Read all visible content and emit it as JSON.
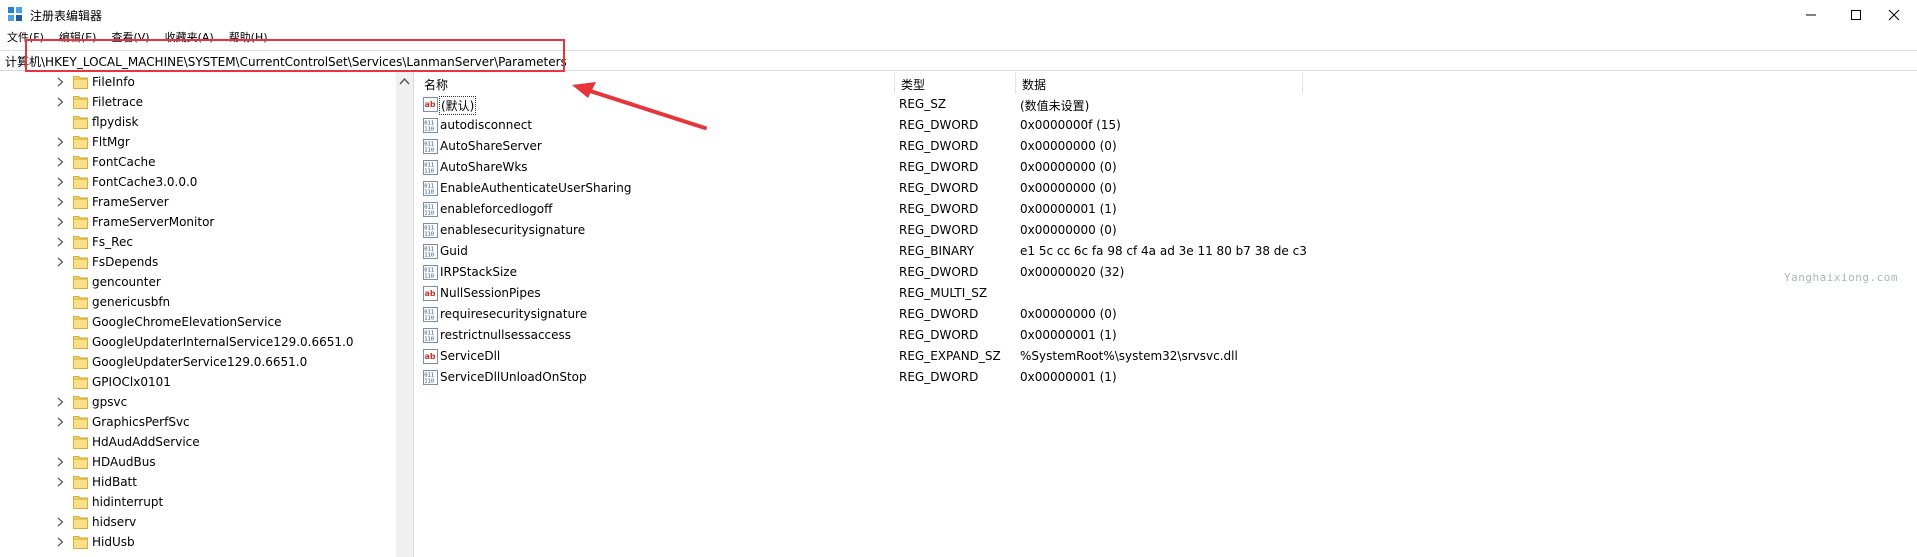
{
  "window": {
    "title": "注册表编辑器",
    "controls": [
      "minimize-icon",
      "maximize-icon",
      "close-icon"
    ]
  },
  "menu": [
    "文件(F)",
    "编辑(E)",
    "查看(V)",
    "收藏夹(A)",
    "帮助(H)"
  ],
  "address": {
    "path": "计算机\\HKEY_LOCAL_MACHINE\\SYSTEM\\CurrentControlSet\\Services\\LanmanServer\\Parameters"
  },
  "tree": {
    "items": [
      {
        "label": "FileInfo",
        "expandable": true
      },
      {
        "label": "Filetrace",
        "expandable": true
      },
      {
        "label": "flpydisk",
        "expandable": false
      },
      {
        "label": "FltMgr",
        "expandable": true
      },
      {
        "label": "FontCache",
        "expandable": true
      },
      {
        "label": "FontCache3.0.0.0",
        "expandable": true
      },
      {
        "label": "FrameServer",
        "expandable": true
      },
      {
        "label": "FrameServerMonitor",
        "expandable": true
      },
      {
        "label": "Fs_Rec",
        "expandable": true
      },
      {
        "label": "FsDepends",
        "expandable": true
      },
      {
        "label": "gencounter",
        "expandable": false
      },
      {
        "label": "genericusbfn",
        "expandable": false
      },
      {
        "label": "GoogleChromeElevationService",
        "expandable": false
      },
      {
        "label": "GoogleUpdaterInternalService129.0.6651.0",
        "expandable": false
      },
      {
        "label": "GoogleUpdaterService129.0.6651.0",
        "expandable": false
      },
      {
        "label": "GPIOClx0101",
        "expandable": false
      },
      {
        "label": "gpsvc",
        "expandable": true
      },
      {
        "label": "GraphicsPerfSvc",
        "expandable": true
      },
      {
        "label": "HdAudAddService",
        "expandable": false
      },
      {
        "label": "HDAudBus",
        "expandable": true
      },
      {
        "label": "HidBatt",
        "expandable": true
      },
      {
        "label": "hidinterrupt",
        "expandable": false
      },
      {
        "label": "hidserv",
        "expandable": true
      },
      {
        "label": "HidUsb",
        "expandable": true
      }
    ]
  },
  "list": {
    "columns": [
      "名称",
      "类型",
      "数据"
    ],
    "rows": [
      {
        "name": "(默认)",
        "type": "REG_SZ",
        "data": "(数值未设置)",
        "icon": "string-value-icon"
      },
      {
        "name": "autodisconnect",
        "type": "REG_DWORD",
        "data": "0x0000000f (15)",
        "icon": "binary-value-icon"
      },
      {
        "name": "AutoShareServer",
        "type": "REG_DWORD",
        "data": "0x00000000 (0)",
        "icon": "binary-value-icon"
      },
      {
        "name": "AutoShareWks",
        "type": "REG_DWORD",
        "data": "0x00000000 (0)",
        "icon": "binary-value-icon"
      },
      {
        "name": "EnableAuthenticateUserSharing",
        "type": "REG_DWORD",
        "data": "0x00000000 (0)",
        "icon": "binary-value-icon"
      },
      {
        "name": "enableforcedlogoff",
        "type": "REG_DWORD",
        "data": "0x00000001 (1)",
        "icon": "binary-value-icon"
      },
      {
        "name": "enablesecuritysignature",
        "type": "REG_DWORD",
        "data": "0x00000000 (0)",
        "icon": "binary-value-icon"
      },
      {
        "name": "Guid",
        "type": "REG_BINARY",
        "data": "e1 5c cc 6c fa 98 cf 4a ad 3e 11 80 b7 38 de c3",
        "icon": "binary-value-icon"
      },
      {
        "name": "IRPStackSize",
        "type": "REG_DWORD",
        "data": "0x00000020 (32)",
        "icon": "binary-value-icon"
      },
      {
        "name": "NullSessionPipes",
        "type": "REG_MULTI_SZ",
        "data": "",
        "icon": "string-value-icon"
      },
      {
        "name": "requiresecuritysignature",
        "type": "REG_DWORD",
        "data": "0x00000000 (0)",
        "icon": "binary-value-icon"
      },
      {
        "name": "restrictnullsessaccess",
        "type": "REG_DWORD",
        "data": "0x00000001 (1)",
        "icon": "binary-value-icon"
      },
      {
        "name": "ServiceDll",
        "type": "REG_EXPAND_SZ",
        "data": "%SystemRoot%\\system32\\srvsvc.dll",
        "icon": "string-value-icon"
      },
      {
        "name": "ServiceDllUnloadOnStop",
        "type": "REG_DWORD",
        "data": "0x00000001 (1)",
        "icon": "binary-value-icon"
      }
    ]
  },
  "watermark": "Yanghaixiong.com",
  "colors": {
    "annotation": "#e8343b",
    "folder": "#f7d26b",
    "selection_outline": "#333333"
  }
}
